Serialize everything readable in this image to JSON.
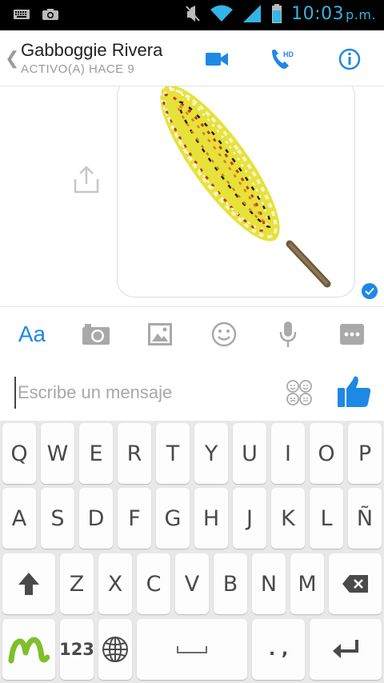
{
  "status_bar": {
    "time": "10:03",
    "ampm": "p.m.",
    "icons": [
      "keyboard-icon",
      "camera-notification-icon",
      "mute-icon",
      "wifi-icon",
      "signal-icon",
      "battery-icon"
    ]
  },
  "header": {
    "contact_name": "Gabboggie Rivera",
    "status": "ACTIVO(A) HACE 9",
    "icons": [
      "back-chevron-icon",
      "video-call-icon",
      "hd-call-icon",
      "info-icon"
    ],
    "hd_badge": "HD",
    "accent": "#1e88e5"
  },
  "chat": {
    "image_description_icon": "corn-on-stick-image",
    "seen_icon": "check-icon"
  },
  "toolbar": {
    "aa_label": "Aa",
    "icons": [
      "camera-icon",
      "gallery-icon",
      "emoji-icon",
      "microphone-icon",
      "more-icon"
    ]
  },
  "composer": {
    "placeholder": "Escribe un mensaje",
    "value": ""
  },
  "keyboard": {
    "row1": [
      "Q",
      "W",
      "E",
      "R",
      "T",
      "Y",
      "U",
      "I",
      "O",
      "P"
    ],
    "row2": [
      "A",
      "S",
      "D",
      "F",
      "G",
      "H",
      "J",
      "K",
      "L",
      "Ñ"
    ],
    "row3": [
      "Z",
      "X",
      "C",
      "V",
      "B",
      "N",
      "M"
    ],
    "numbers_label": "123",
    "punct_label": ". ,",
    "brand_icon": "movistar-logo-icon"
  }
}
